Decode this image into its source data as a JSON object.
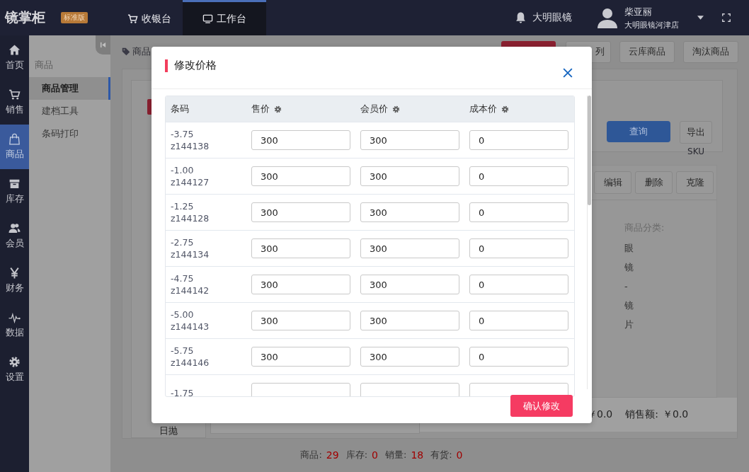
{
  "topbar": {
    "logo": "镜掌柜",
    "edition": "标准版",
    "tabs": [
      {
        "label": "收银台",
        "selected": false
      },
      {
        "label": "工作台",
        "selected": true
      }
    ],
    "store": "大明眼镜",
    "user": {
      "name": "柴亚丽",
      "branch": "大明眼镜河津店"
    }
  },
  "nav": [
    {
      "label": "首页",
      "selected": false
    },
    {
      "label": "销售",
      "selected": false
    },
    {
      "label": "商品",
      "selected": true
    },
    {
      "label": "库存",
      "selected": false
    },
    {
      "label": "会员",
      "selected": false
    },
    {
      "label": "财务",
      "selected": false
    },
    {
      "label": "数据",
      "selected": false
    },
    {
      "label": "设置",
      "selected": false
    }
  ],
  "subnav": {
    "title": "商品",
    "items": [
      {
        "label": "商品管理",
        "selected": true
      },
      {
        "label": "建档工具",
        "selected": false
      },
      {
        "label": "条码打印",
        "selected": false
      }
    ]
  },
  "page": {
    "breadcrumb": "商品",
    "top_buttons": [
      {
        "kind": "danger"
      },
      {
        "kind": "plain",
        "label": "列"
      },
      {
        "kind": "plain",
        "label": "云库商品"
      },
      {
        "kind": "plain",
        "label": "淘汰商品"
      }
    ],
    "left_panel": {
      "item": "日抛"
    },
    "filter": {
      "query_button": "查询",
      "export_button": "导出",
      "sku": "SKU"
    },
    "detail": {
      "actions": [
        "编辑",
        "删除",
        "克隆"
      ],
      "category_label": "商品分类:",
      "category_value": "眼镜-镜片"
    },
    "totals": [
      {
        "value": "￥0.0"
      },
      {
        "label": "销售额:",
        "value": "￥0.0"
      }
    ],
    "stats": [
      {
        "label": "商品:",
        "value": "29"
      },
      {
        "label": "库存:",
        "value": "0"
      },
      {
        "label": "销量:",
        "value": "18"
      },
      {
        "label": "有货:",
        "value": "0"
      }
    ]
  },
  "modal": {
    "title": "修改价格",
    "columns": [
      "条码",
      "售价",
      "会员价",
      "成本价"
    ],
    "rows": [
      {
        "size": "-3.75",
        "code": "z144138",
        "price": "300",
        "member_price": "300",
        "cost": "0"
      },
      {
        "size": "-1.00",
        "code": "z144127",
        "price": "300",
        "member_price": "300",
        "cost": "0"
      },
      {
        "size": "-1.25",
        "code": "z144128",
        "price": "300",
        "member_price": "300",
        "cost": "0"
      },
      {
        "size": "-2.75",
        "code": "z144134",
        "price": "300",
        "member_price": "300",
        "cost": "0"
      },
      {
        "size": "-4.75",
        "code": "z144142",
        "price": "300",
        "member_price": "300",
        "cost": "0"
      },
      {
        "size": "-5.00",
        "code": "z144143",
        "price": "300",
        "member_price": "300",
        "cost": "0"
      },
      {
        "size": "-5.75",
        "code": "z144146",
        "price": "300",
        "member_price": "300",
        "cost": "0"
      },
      {
        "size": "-1.75"
      }
    ],
    "confirm_button": "确认修改"
  }
}
